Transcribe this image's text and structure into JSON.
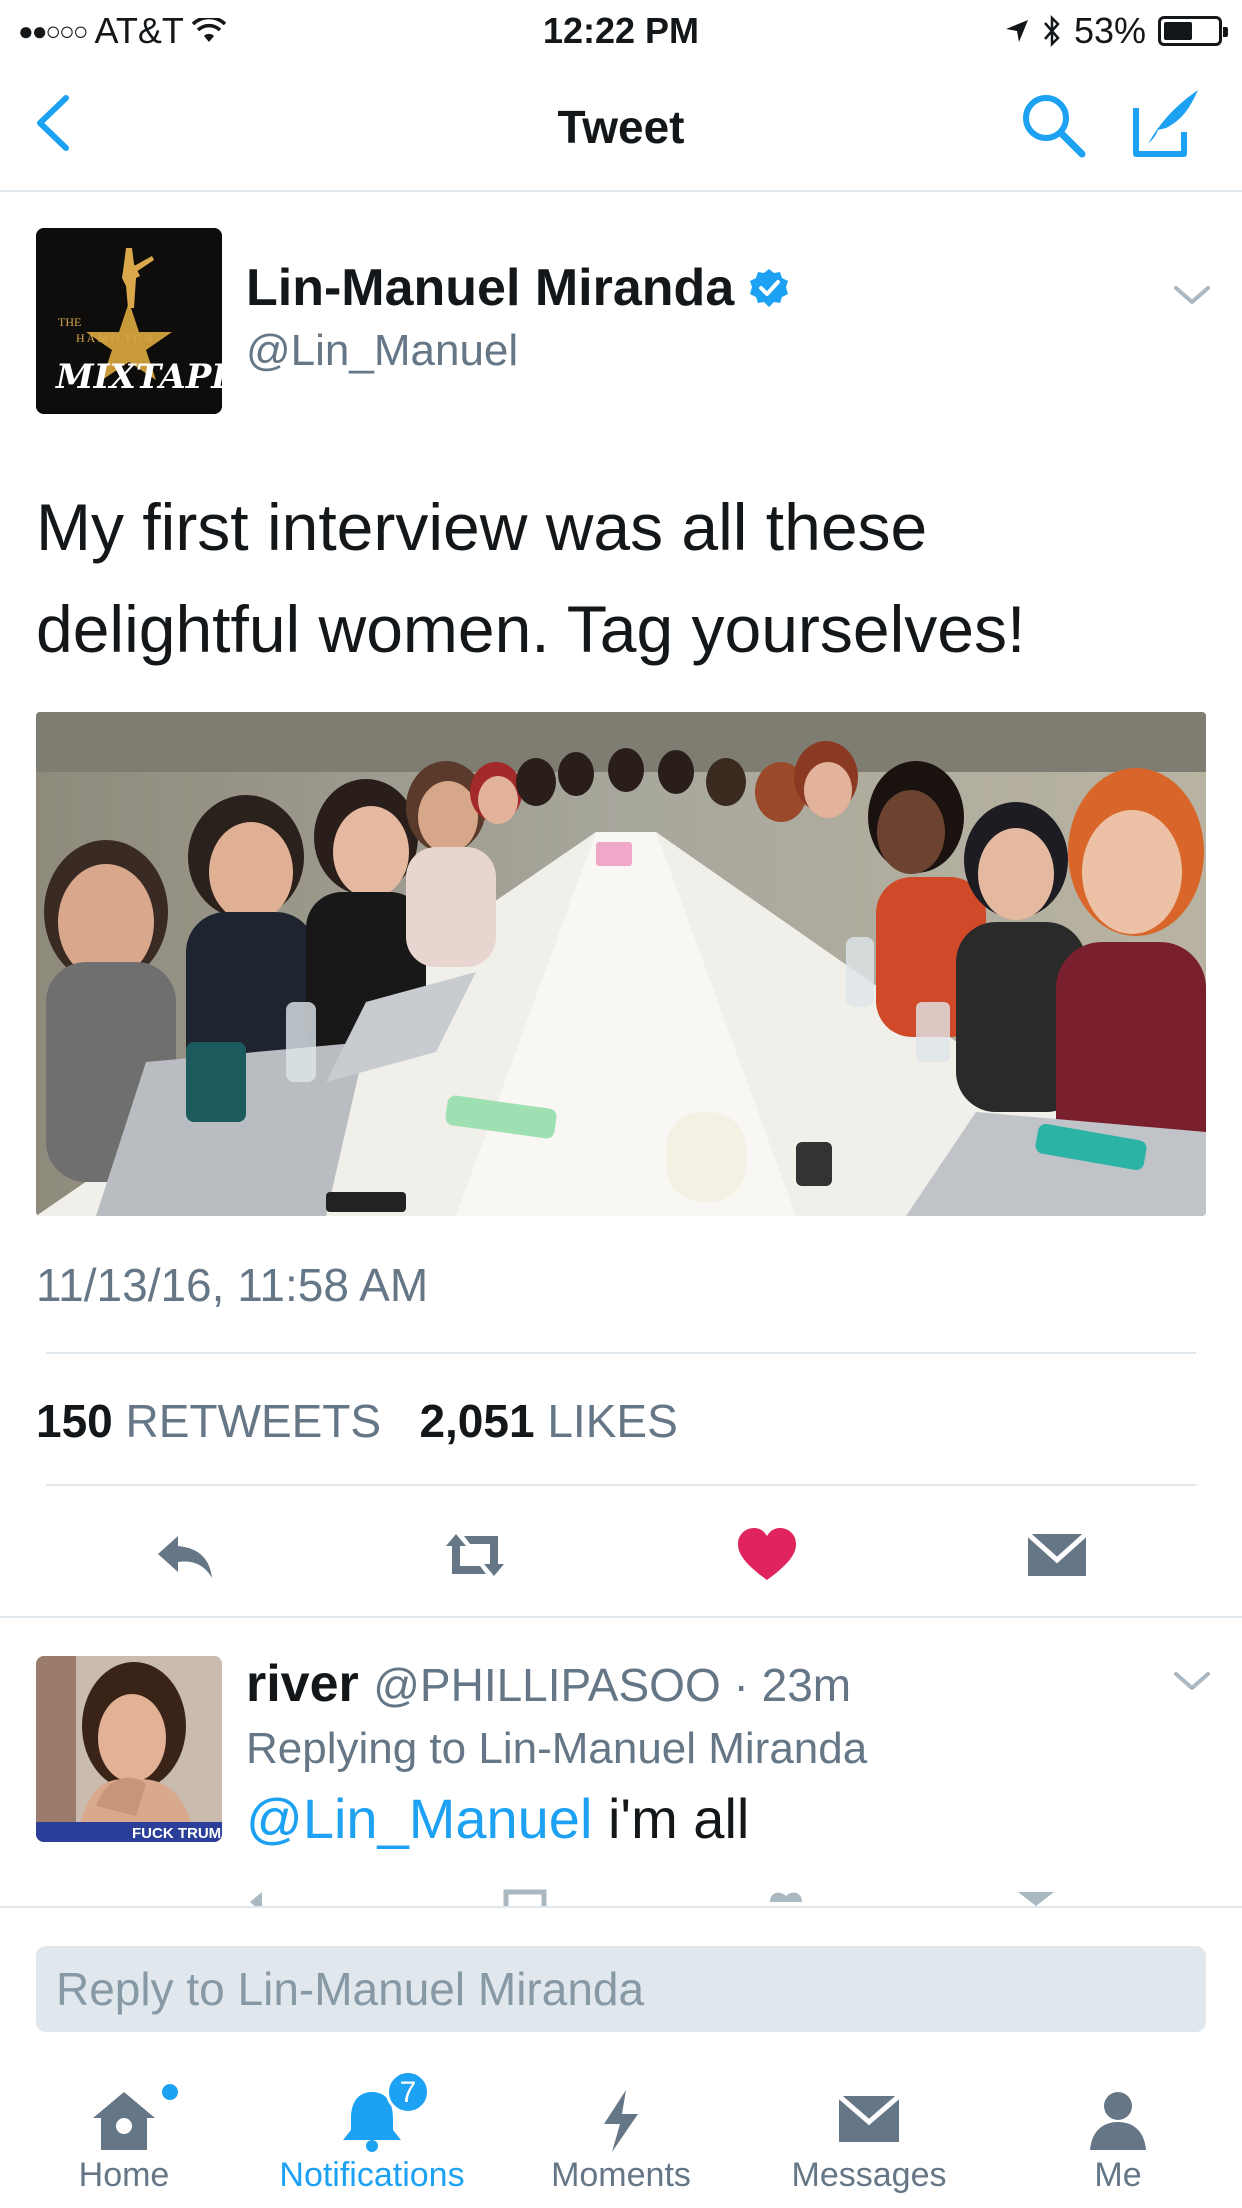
{
  "status_bar": {
    "carrier": "AT&T",
    "time": "12:22 PM",
    "battery": "53%",
    "battery_level": 0.53
  },
  "nav": {
    "title": "Tweet",
    "back_icon": "chevron-left-icon",
    "search_icon": "search-icon",
    "compose_icon": "compose-icon"
  },
  "tweet": {
    "author_name": "Lin-Manuel Miranda",
    "author_handle": "@Lin_Manuel",
    "text": "My first interview was all these delightful women. Tag yourselves!",
    "timestamp": "11/13/16, 11:58 AM",
    "retweets_count": "150",
    "retweets_label": "RETWEETS",
    "likes_count": "2,051",
    "likes_label": "LIKES",
    "avatar_text": {
      "the": "THE",
      "hamilton": "HAMILTON",
      "mixtape": "MIXTAPE"
    }
  },
  "reply": {
    "name": "river",
    "handle": "@PHILLIPASOO",
    "time_ago": "23m",
    "replying_to": "Replying to Lin-Manuel Miranda",
    "mention": "@Lin_Manuel",
    "text": "i'm all",
    "avatar_caption": "FUCK TRUMP"
  },
  "reply_box": {
    "placeholder": "Reply to Lin-Manuel Miranda"
  },
  "tabs": [
    {
      "label": "Home",
      "icon": "home-icon"
    },
    {
      "label": "Notifications",
      "icon": "bell-icon",
      "badge": "7"
    },
    {
      "label": "Moments",
      "icon": "lightning-icon"
    },
    {
      "label": "Messages",
      "icon": "envelope-icon"
    },
    {
      "label": "Me",
      "icon": "person-icon"
    }
  ],
  "colors": {
    "accent": "#1da1f2",
    "like": "#e0245e",
    "secondary_text": "#657786",
    "primary_text": "#14171a"
  }
}
